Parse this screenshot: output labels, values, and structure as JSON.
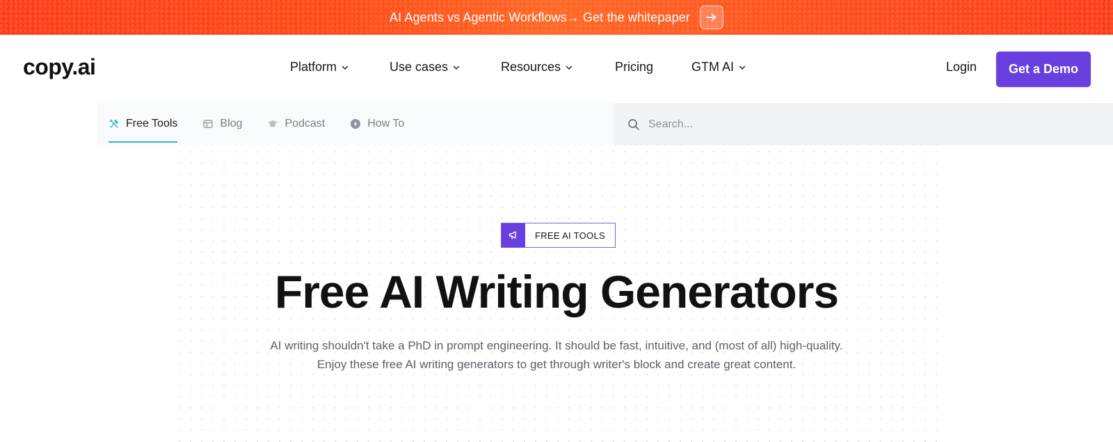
{
  "promo": {
    "text": "AI Agents vs Agentic Workflows→ Get the whitepaper",
    "arrow_icon": "arrow-right-icon"
  },
  "header": {
    "logo": "copy.ai",
    "menu": [
      {
        "label": "Platform",
        "has_dropdown": true
      },
      {
        "label": "Use cases",
        "has_dropdown": true
      },
      {
        "label": "Resources",
        "has_dropdown": true
      },
      {
        "label": "Pricing",
        "has_dropdown": false
      },
      {
        "label": "GTM AI",
        "has_dropdown": true
      }
    ],
    "login_label": "Login",
    "demo_label": "Get a Demo"
  },
  "subnav": {
    "tabs": [
      {
        "label": "Free Tools",
        "icon": "tools-icon",
        "active": true
      },
      {
        "label": "Blog",
        "icon": "blog-icon",
        "active": false
      },
      {
        "label": "Podcast",
        "icon": "podcast-icon",
        "active": false
      },
      {
        "label": "How To",
        "icon": "how-to-icon",
        "active": false
      }
    ],
    "search_placeholder": "Search..."
  },
  "hero": {
    "badge_label": "FREE AI TOOLS",
    "badge_icon": "megaphone-icon",
    "title": "Free AI Writing Generators",
    "subtitle_line1": "AI writing shouldn't take a PhD in prompt engineering. It should be fast, intuitive, and (most of all) high-quality.",
    "subtitle_line2": "Enjoy these free AI writing generators to get through writer's block and create great content."
  },
  "colors": {
    "accent": "#6a3fe0",
    "promo_bg": "#ff4a1c",
    "tab_underline": "#3bb4c1"
  }
}
